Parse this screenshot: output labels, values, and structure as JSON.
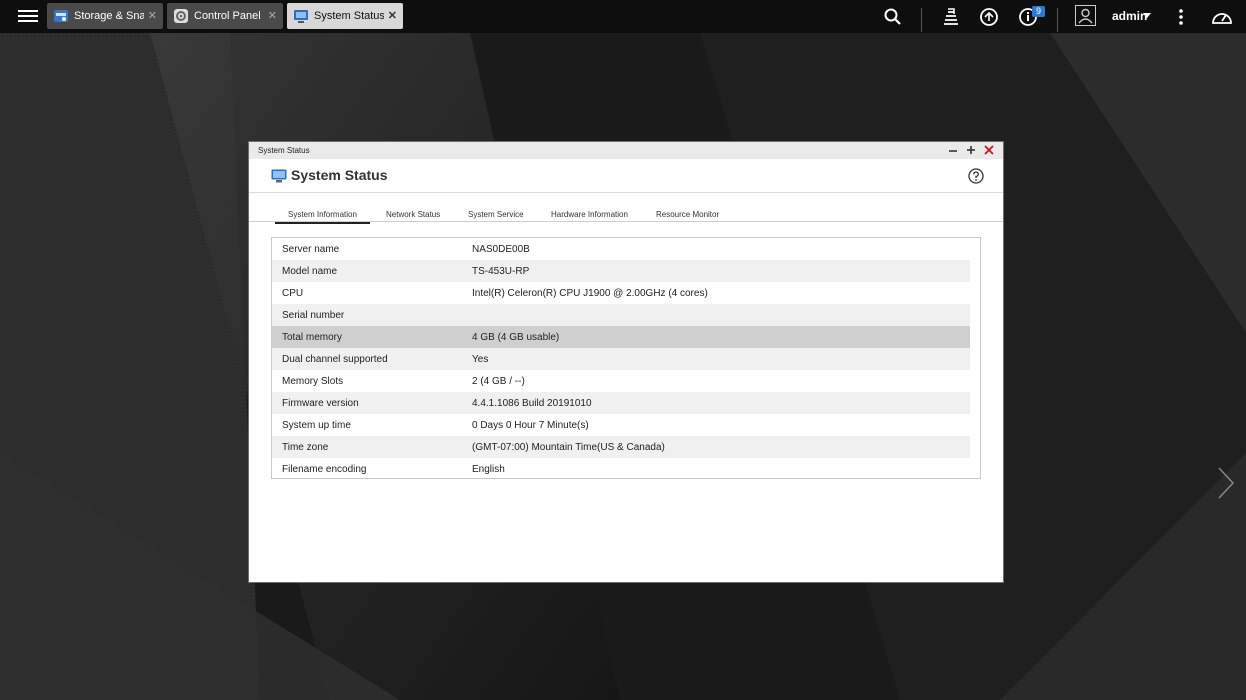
{
  "topbar": {
    "tabs": [
      {
        "label": "Storage & Sna...",
        "icon": "storage-snapshots-icon",
        "active": false
      },
      {
        "label": "Control Panel",
        "icon": "control-panel-icon",
        "active": false
      },
      {
        "label": "System Status",
        "icon": "system-status-icon",
        "active": true
      }
    ],
    "notification_count": "9",
    "user": "admin"
  },
  "window": {
    "title": "System Status",
    "app_title": "System Status",
    "tabs": [
      "System Information",
      "Network Status",
      "System Service",
      "Hardware Information",
      "Resource Monitor"
    ],
    "active_tab": "System Information",
    "rows": [
      {
        "label": "Server name",
        "value": "NAS0DE00B"
      },
      {
        "label": "Model name",
        "value": "TS-453U-RP"
      },
      {
        "label": "CPU",
        "value": "Intel(R) Celeron(R) CPU J1900 @ 2.00GHz (4 cores)"
      },
      {
        "label": "Serial number",
        "value": ""
      },
      {
        "label": "Total memory",
        "value": "4 GB (4 GB usable)"
      },
      {
        "label": "Dual channel supported",
        "value": "Yes"
      },
      {
        "label": "Memory Slots",
        "value": "2 (4 GB / --)"
      },
      {
        "label": "Firmware version",
        "value": "4.4.1.1086 Build 20191010"
      },
      {
        "label": "System up time",
        "value": "0 Days 0 Hour 7 Minute(s)"
      },
      {
        "label": "Time zone",
        "value": "(GMT-07:00) Mountain Time(US & Canada)"
      },
      {
        "label": "Filename encoding",
        "value": "English"
      }
    ]
  },
  "colors": {
    "topbar_bg": "#0e0e0e",
    "desktop_bg": "#1c1c1c",
    "accent": "#2b7ad6",
    "highlight_row": "#cfcfcf"
  }
}
